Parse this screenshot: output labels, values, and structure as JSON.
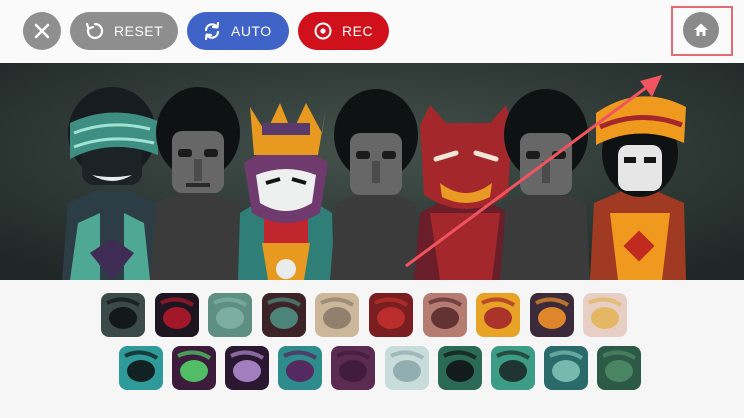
{
  "toolbar": {
    "reset_label": "RESET",
    "auto_label": "AUTO",
    "rec_label": "REC"
  },
  "colors": {
    "reset": "#8e8e8e",
    "auto": "#3f63c6",
    "rec": "#d0111b",
    "highlight": "#e36b73",
    "stage_bg": "#27322f"
  },
  "icons": {
    "close": "close-icon",
    "reset": "reset-icon",
    "auto": "auto-icon",
    "rec": "record-icon",
    "home": "home-icon"
  },
  "stage": {
    "characters": [
      {
        "name": "teal-swirl-performer",
        "color": "#4fa893"
      },
      {
        "name": "gray-performer-1",
        "color": "#6e6e6e"
      },
      {
        "name": "orange-crowned-performer",
        "color": "#e79a1f"
      },
      {
        "name": "gray-performer-2",
        "color": "#6e6e6e"
      },
      {
        "name": "red-masked-performer",
        "color": "#a3272b"
      },
      {
        "name": "gray-performer-3",
        "color": "#6e6e6e"
      },
      {
        "name": "orange-turban-performer",
        "color": "#ef9a1f"
      }
    ]
  },
  "sound_tiles": {
    "row1": [
      {
        "name": "tile-dark-beat",
        "bg": "#3a4a49",
        "fg": "#0f1414"
      },
      {
        "name": "tile-red-eye",
        "bg": "#1d1620",
        "fg": "#b3182a"
      },
      {
        "name": "tile-teal-stripes",
        "bg": "#5e8f82",
        "fg": "#7fb2a3"
      },
      {
        "name": "tile-crossed-bones",
        "bg": "#3b2328",
        "fg": "#4f8f82"
      },
      {
        "name": "tile-tan-lines",
        "bg": "#cdb79a",
        "fg": "#8a7a68"
      },
      {
        "name": "tile-red-stick",
        "bg": "#7a1e22",
        "fg": "#c0302f"
      },
      {
        "name": "tile-masked-face",
        "bg": "#b57d72",
        "fg": "#5a2a2c"
      },
      {
        "name": "tile-orange-band",
        "bg": "#e8a226",
        "fg": "#a3272b"
      },
      {
        "name": "tile-orange-curl",
        "bg": "#3b2a3a",
        "fg": "#f0902a"
      },
      {
        "name": "tile-lips",
        "bg": "#e8cfc5",
        "fg": "#e4b45a"
      }
    ],
    "row2": [
      {
        "name": "tile-teal-shade",
        "bg": "#2e9b9a",
        "fg": "#0f1414"
      },
      {
        "name": "tile-green-orb",
        "bg": "#3d1b3a",
        "fg": "#53d06a"
      },
      {
        "name": "tile-goggles",
        "bg": "#2a1830",
        "fg": "#b08acf"
      },
      {
        "name": "tile-purple-spike",
        "bg": "#2e8d8c",
        "fg": "#5a1f5c"
      },
      {
        "name": "tile-plum-shade",
        "bg": "#5c2b52",
        "fg": "#3f1b3a"
      },
      {
        "name": "tile-pale-weave",
        "bg": "#c9dcdc",
        "fg": "#8da9ab"
      },
      {
        "name": "tile-green-swirl",
        "bg": "#2b6b55",
        "fg": "#0f1414"
      },
      {
        "name": "tile-green-hat",
        "bg": "#3d9c86",
        "fg": "#1b2a2a"
      },
      {
        "name": "tile-teal-ring",
        "bg": "#2b6a6a",
        "fg": "#7fc2b4"
      },
      {
        "name": "tile-green-bubbles",
        "bg": "#2d5a46",
        "fg": "#4e8a66"
      }
    ]
  }
}
